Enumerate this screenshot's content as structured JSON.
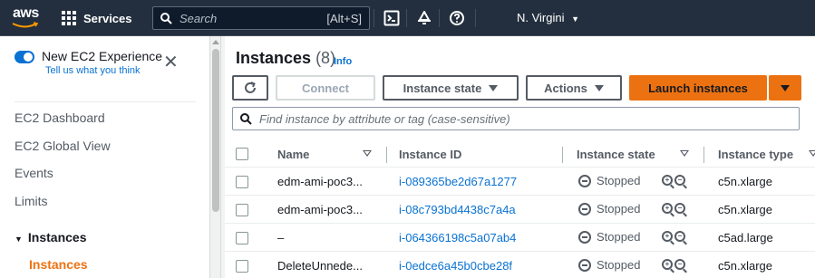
{
  "topnav": {
    "logo_text": "aws",
    "services_label": "Services",
    "search_placeholder": "Search",
    "search_shortcut": "[Alt+S]",
    "region_label": "N. Virgini",
    "icons": [
      "cloudshell-icon",
      "notifications-bell-icon",
      "help-icon"
    ]
  },
  "sidebar": {
    "toggle_title": "New EC2 Experience",
    "toggle_link": "Tell us what you think",
    "toggle_on": true,
    "items": [
      "EC2 Dashboard",
      "EC2 Global View",
      "Events",
      "Limits"
    ],
    "section_label": "Instances",
    "active_item": "Instances"
  },
  "main": {
    "title": "Instances",
    "count": "(8)",
    "info_label": "Info",
    "buttons": {
      "refresh_icon": "refresh-icon",
      "connect": "Connect",
      "instance_state": "Instance state",
      "actions": "Actions",
      "launch": "Launch instances"
    },
    "filter_placeholder": "Find instance by attribute or tag (case-sensitive)",
    "columns": [
      "Name",
      "Instance ID",
      "Instance state",
      "Instance type"
    ],
    "rows": [
      {
        "name": "edm-ami-poc3...",
        "id": "i-089365be2d67a1277",
        "state": "Stopped",
        "type": "c5n.xlarge"
      },
      {
        "name": "edm-ami-poc3...",
        "id": "i-08c793bd4438c7a4a",
        "state": "Stopped",
        "type": "c5n.xlarge"
      },
      {
        "name": "–",
        "id": "i-064366198c5a07ab4",
        "state": "Stopped",
        "type": "c5ad.large"
      },
      {
        "name": "DeleteUnnede...",
        "id": "i-0edce6a45b0cbe28f",
        "state": "Stopped",
        "type": "c5n.xlarge"
      }
    ]
  },
  "colors": {
    "topnav_bg": "#232f3e",
    "link": "#0972d3",
    "accent_orange": "#ec7211"
  }
}
